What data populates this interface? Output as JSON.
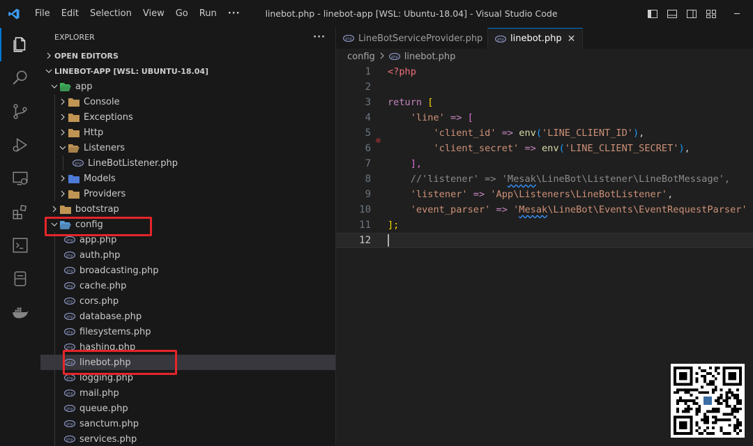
{
  "app": {
    "menu": [
      "File",
      "Edit",
      "Selection",
      "View",
      "Go",
      "Run",
      "···"
    ],
    "window_title": "linebot.php - linebot-app [WSL: Ubuntu-18.04] - Visual Studio Code",
    "window_controls": {
      "minimize": "─"
    },
    "icons": {
      "logo": "vscode-logo-icon",
      "layout": [
        "toggle-sidebar-icon",
        "toggle-panel-icon",
        "toggle-secondary-sidebar-icon",
        "customize-layout-icon"
      ],
      "activity": [
        "explorer-icon",
        "search-icon",
        "source-control-icon",
        "run-debug-icon",
        "remote-explorer-icon",
        "extensions-icon",
        "terminal-icon",
        "database-icon",
        "docker-icon"
      ]
    },
    "colors": {
      "accent": "#0078d4",
      "highlight_box": "#e5252a",
      "folder": "#c09553",
      "php_file": "#8892bf"
    }
  },
  "sidebar": {
    "title": "EXPLORER",
    "more": "···",
    "open_editors": "OPEN EDITORS",
    "project": "LINEBOT-APP [WSL: UBUNTU-18.04]",
    "tree": [
      {
        "label": "app",
        "expanded": true,
        "type": "folder-app"
      },
      {
        "label": "Console",
        "type": "folder"
      },
      {
        "label": "Exceptions",
        "type": "folder"
      },
      {
        "label": "Http",
        "type": "folder"
      },
      {
        "label": "Listeners",
        "expanded": true,
        "type": "folder"
      },
      {
        "label": "LineBotListener.php",
        "type": "php"
      },
      {
        "label": "Models",
        "type": "folder-models"
      },
      {
        "label": "Providers",
        "type": "folder"
      },
      {
        "label": "bootstrap",
        "type": "folder"
      },
      {
        "label": "config",
        "expanded": true,
        "type": "folder-config"
      },
      {
        "label": "app.php",
        "type": "php"
      },
      {
        "label": "auth.php",
        "type": "php"
      },
      {
        "label": "broadcasting.php",
        "type": "php"
      },
      {
        "label": "cache.php",
        "type": "php"
      },
      {
        "label": "cors.php",
        "type": "php"
      },
      {
        "label": "database.php",
        "type": "php"
      },
      {
        "label": "filesystems.php",
        "type": "php"
      },
      {
        "label": "hashing.php",
        "type": "php"
      },
      {
        "label": "linebot.php",
        "type": "php",
        "selected": true
      },
      {
        "label": "logging.php",
        "type": "php"
      },
      {
        "label": "mail.php",
        "type": "php"
      },
      {
        "label": "queue.php",
        "type": "php"
      },
      {
        "label": "sanctum.php",
        "type": "php"
      },
      {
        "label": "services.php",
        "type": "php"
      }
    ]
  },
  "editor": {
    "tabs": [
      {
        "label": "LineBotServiceProvider.php",
        "active": false
      },
      {
        "label": "linebot.php",
        "active": true
      }
    ],
    "tab_close": "✕",
    "breadcrumb": {
      "folder": "config",
      "file": "linebot.php"
    },
    "line_numbers": [
      "1",
      "2",
      "3",
      "4",
      "5",
      "6",
      "7",
      "8",
      "9",
      "10",
      "11",
      "12"
    ],
    "current_line": "12",
    "code": {
      "l1": "<?php",
      "l3_kw": "return",
      "l3_br": "[",
      "l4_key": "'line'",
      "l4_arrow": "=>",
      "l4_br": "[",
      "l5_key": "'client_id'",
      "l5_arrow": "=>",
      "l5_fn": "env",
      "l5_arg": "'LINE_CLIENT_ID'",
      "l6_key": "'client_secret'",
      "l6_arrow": "=>",
      "l6_fn": "env",
      "l6_arg": "'LINE_CLIENT_SECRET'",
      "l7_br": "],",
      "l8_a": "//'listener' => '",
      "l8_b": "Mesak",
      "l8_c": "\\LineBot\\Listener\\LineBotMessage',",
      "l9_key": "'listener'",
      "l9_arrow": "=>",
      "l9_val": "'App\\Listeners\\LineBotListener'",
      "l10_key": "'event_parser'",
      "l10_arrow": "=>",
      "l10_val_a": "'",
      "l10_val_b": "Mesak",
      "l10_val_c": "\\LineBot\\Events\\EventRequestParser'",
      "l11": "];"
    }
  }
}
